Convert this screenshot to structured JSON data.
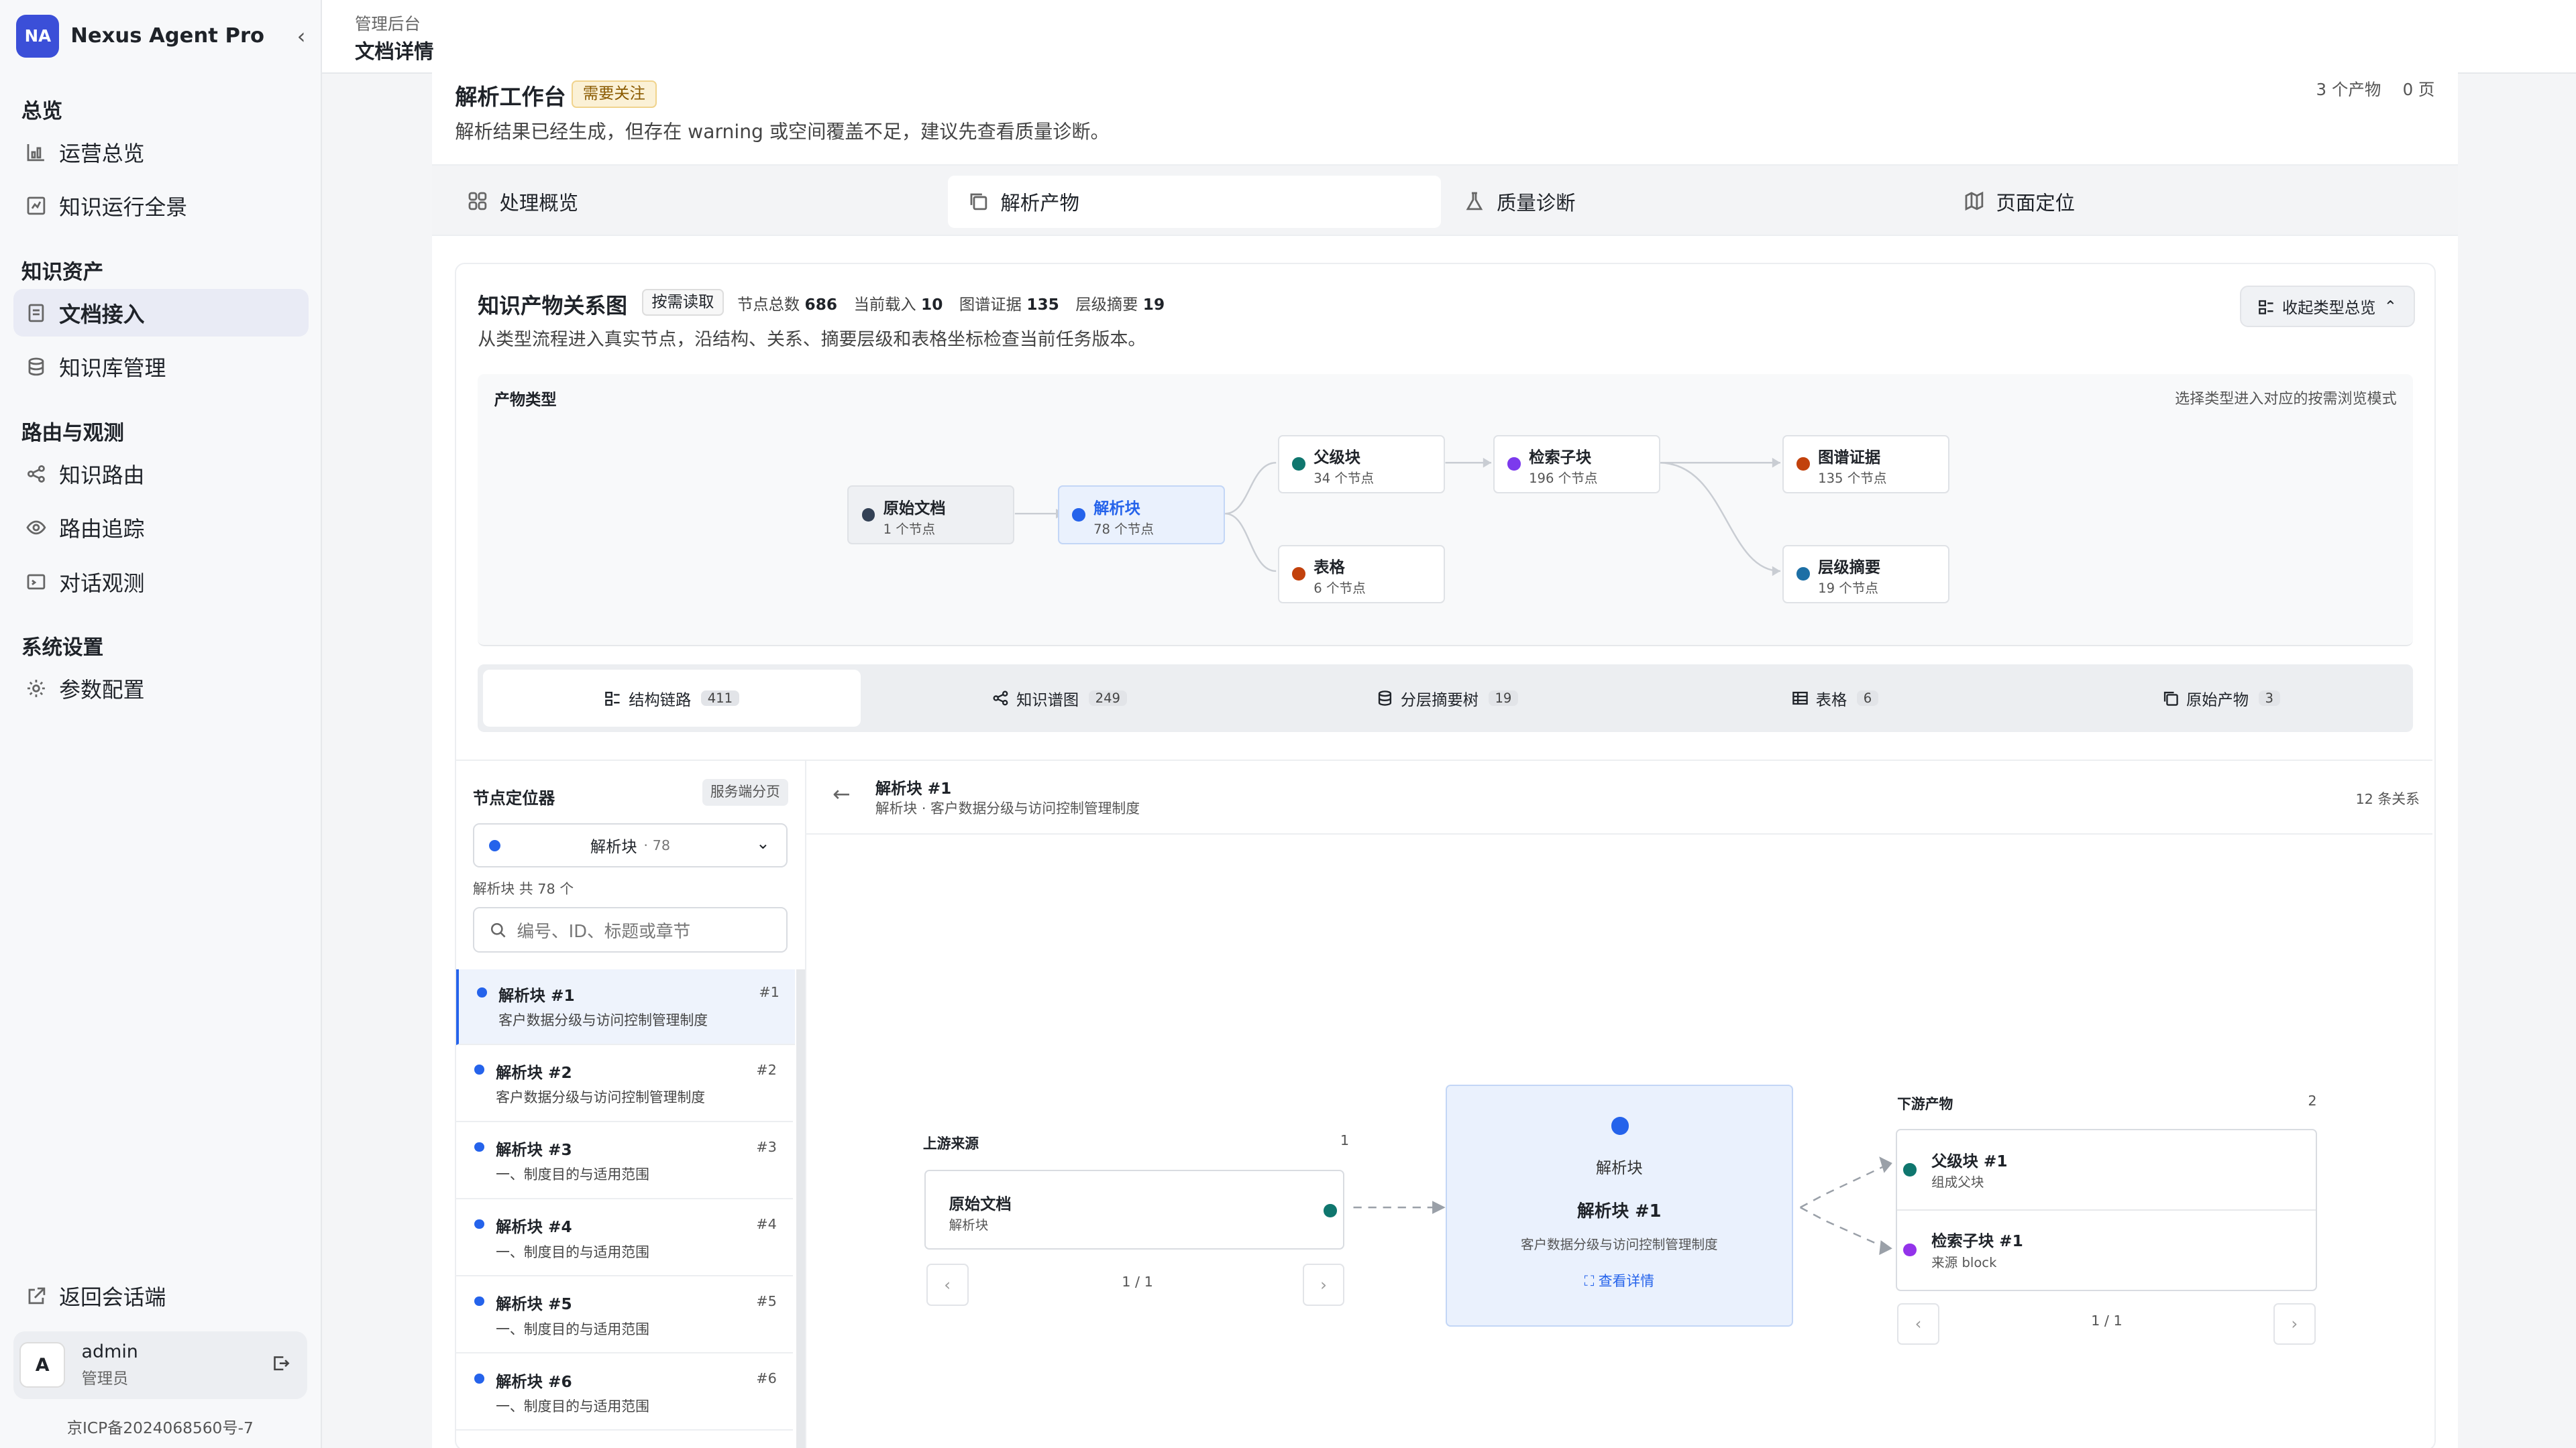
{
  "brand": {
    "logo": "NA",
    "name": "Nexus Agent Pro"
  },
  "sidebar": {
    "groups": [
      {
        "label": "总览",
        "items": [
          {
            "label": "运营总览",
            "icon": "chart-icon"
          },
          {
            "label": "知识运行全景",
            "icon": "dashboard-icon"
          }
        ]
      },
      {
        "label": "知识资产",
        "items": [
          {
            "label": "文档接入",
            "icon": "document-icon",
            "active": true
          },
          {
            "label": "知识库管理",
            "icon": "database-icon"
          }
        ]
      },
      {
        "label": "路由与观测",
        "items": [
          {
            "label": "知识路由",
            "icon": "share-icon"
          },
          {
            "label": "路由追踪",
            "icon": "eye-icon"
          },
          {
            "label": "对话观测",
            "icon": "terminal-icon"
          }
        ]
      },
      {
        "label": "系统设置",
        "items": [
          {
            "label": "参数配置",
            "icon": "gear-icon"
          }
        ]
      }
    ],
    "back_label": "返回会话端",
    "user": {
      "avatar": "A",
      "name": "admin",
      "role": "管理员"
    },
    "icp": "京ICP备2024068560号-7"
  },
  "header": {
    "crumb": "管理后台",
    "title": "文档详情"
  },
  "workspace": {
    "title": "解析工作台",
    "badge": "需要关注",
    "desc": "解析结果已经生成，但存在 warning 或空间覆盖不足，建议先查看质量诊断。",
    "meta_outputs": "3 个产物",
    "meta_pages": "0 页"
  },
  "tabs": [
    {
      "label": "处理概览",
      "icon": "grid-icon"
    },
    {
      "label": "解析产物",
      "icon": "copy-icon",
      "active": true
    },
    {
      "label": "质量诊断",
      "icon": "flask-icon"
    },
    {
      "label": "页面定位",
      "icon": "map-icon"
    }
  ],
  "kg": {
    "title": "知识产物关系图",
    "badge": "按需读取",
    "stats": [
      {
        "label": "节点总数",
        "value": "686"
      },
      {
        "label": "当前载入",
        "value": "10"
      },
      {
        "label": "图谱证据",
        "value": "135"
      },
      {
        "label": "层级摘要",
        "value": "19"
      }
    ],
    "desc": "从类型流程进入真实节点，沿结构、关系、摘要层级和表格坐标检查当前任务版本。",
    "collapse_label": "收起类型总览",
    "flow_label": "产物类型",
    "flow_hint": "选择类型进入对应的按需浏览模式",
    "flow_nodes": [
      {
        "id": "raw",
        "name": "原始文档",
        "count": "1 个节点",
        "color": "#334155"
      },
      {
        "id": "parse",
        "name": "解析块",
        "count": "78 个节点",
        "color": "#2563eb"
      },
      {
        "id": "parent",
        "name": "父级块",
        "count": "34 个节点",
        "color": "#0f766e"
      },
      {
        "id": "table",
        "name": "表格",
        "count": "6 个节点",
        "color": "#c2410c"
      },
      {
        "id": "retrieve",
        "name": "检索子块",
        "count": "196 个节点",
        "color": "#7c3aed"
      },
      {
        "id": "evidence",
        "name": "图谱证据",
        "count": "135 个节点",
        "color": "#c2410c"
      },
      {
        "id": "summary",
        "name": "层级摘要",
        "count": "19 个节点",
        "color": "#1d6fa5"
      }
    ]
  },
  "view_tabs": [
    {
      "label": "结构链路",
      "count": "411",
      "icon": "structure-icon",
      "active": true
    },
    {
      "label": "知识谱图",
      "count": "249",
      "icon": "share-icon"
    },
    {
      "label": "分层摘要树",
      "count": "19",
      "icon": "layers-icon"
    },
    {
      "label": "表格",
      "count": "6",
      "icon": "table-icon"
    },
    {
      "label": "原始产物",
      "count": "3",
      "icon": "copy-icon"
    }
  ],
  "locator": {
    "title": "节点定位器",
    "paging_label": "服务端分页",
    "select_value": "解析块",
    "select_count": "· 78",
    "total_label": "解析块 共 78 个",
    "search_placeholder": "编号、ID、标题或章节",
    "items": [
      {
        "title": "解析块 #1",
        "num": "#1",
        "sub": "客户数据分级与访问控制管理制度",
        "active": true
      },
      {
        "title": "解析块 #2",
        "num": "#2",
        "sub": "客户数据分级与访问控制管理制度"
      },
      {
        "title": "解析块 #3",
        "num": "#3",
        "sub": "一、制度目的与适用范围"
      },
      {
        "title": "解析块 #4",
        "num": "#4",
        "sub": "一、制度目的与适用范围"
      },
      {
        "title": "解析块 #5",
        "num": "#5",
        "sub": "一、制度目的与适用范围"
      },
      {
        "title": "解析块 #6",
        "num": "#6",
        "sub": "一、制度目的与适用范围"
      }
    ]
  },
  "graph": {
    "title": "解析块 #1",
    "sub": "解析块 · 客户数据分级与访问控制管理制度",
    "relations": "12 条关系",
    "upstream": {
      "label": "上游来源",
      "count": "1",
      "card_title": "原始文档",
      "card_sub": "解析块",
      "pager": "1 / 1"
    },
    "center": {
      "type": "解析块",
      "title": "解析块 #1",
      "sub": "客户数据分级与访问控制管理制度",
      "link": "查看详情"
    },
    "downstream": {
      "label": "下游产物",
      "count": "2",
      "pager": "1 / 1",
      "items": [
        {
          "title": "父级块 #1",
          "sub": "组成父块",
          "color": "#0f766e"
        },
        {
          "title": "检索子块 #1",
          "sub": "来源 block",
          "color": "#9333ea"
        }
      ]
    }
  }
}
